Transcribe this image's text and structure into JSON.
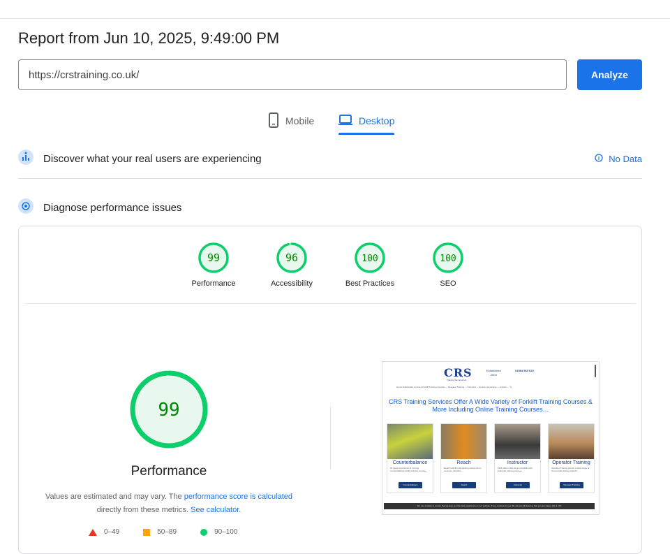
{
  "report": {
    "title": "Report from Jun 10, 2025, 9:49:00 PM",
    "url": "https://crstraining.co.uk/",
    "analyze_label": "Analyze"
  },
  "tabs": {
    "mobile": "Mobile",
    "desktop": "Desktop",
    "active": "desktop"
  },
  "field_data": {
    "label": "Discover what your real users are experiencing",
    "status": "No Data"
  },
  "diagnose": {
    "label": "Diagnose performance issues"
  },
  "categories": [
    {
      "label": "Performance",
      "score": "99",
      "value": 99
    },
    {
      "label": "Accessibility",
      "score": "96",
      "value": 96
    },
    {
      "label": "Best Practices",
      "score": "100",
      "value": 100
    },
    {
      "label": "SEO",
      "score": "100",
      "value": 100
    }
  ],
  "performance": {
    "score": "99",
    "value": 99,
    "title": "Performance",
    "note_prefix": "Values are estimated and may vary. The ",
    "note_link1": "performance score is calculated",
    "note_mid": " directly from these metrics. ",
    "note_link2": "See calculator."
  },
  "legend": {
    "fail": "0–49",
    "average": "50–89",
    "pass": "90–100"
  },
  "colors": {
    "pass": "#0cce6b",
    "pass_text": "#008800",
    "pass_fill": "#e8f8ee",
    "average": "#ffa400",
    "fail": "#eb3323",
    "accent": "#1a73e8"
  },
  "thumbnail": {
    "logo": "CRS",
    "logo_sub": "Training Services Ltd",
    "established": "Established",
    "est_year": "2004",
    "phone": "01984 563 620",
    "nav": "Home    Telehandler Courses    Forklift Training Courses ⌄    Operator Training ⌄    Instructor ⌄    Courses    eLearning ⌄    Contact ⌄    🔍",
    "headline": "CRS Training Services Offer A Wide Variety of Forklift Training Courses & More Including Online Training Courses…",
    "cards": [
      {
        "title": "Counterbalance",
        "text": "20 years experience in running counterbalance forklift training courses.",
        "button": "Counterbalance"
      },
      {
        "title": "Reach",
        "text": "Reach forklift truck training courses from novice to refresher.",
        "button": "Reach"
      },
      {
        "title": "Instructor",
        "text": "CRS offers a full range of forklift truck instructor training courses.",
        "button": "Instructor"
      },
      {
        "title": "Operator Training",
        "text": "Operator Training across a wide range of commercial driving subjects.",
        "button": "Operator Training"
      }
    ],
    "cookie": "We use cookies to ensure that we give you the best experience on our website. If you continue to use this site we will assume that you are happy with it.   OK"
  }
}
